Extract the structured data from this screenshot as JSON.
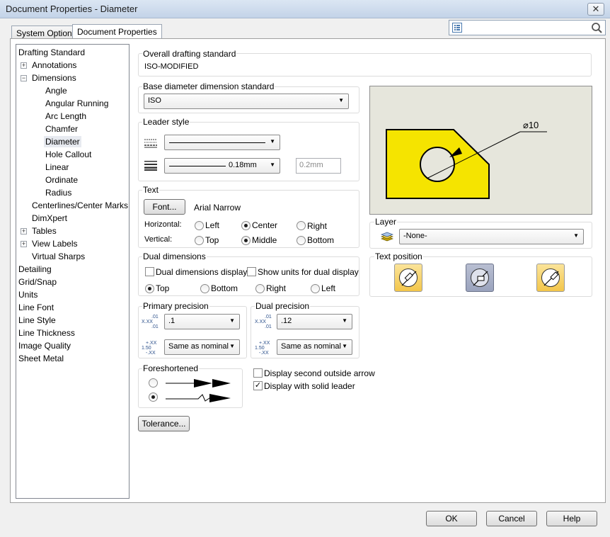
{
  "window": {
    "title": "Document Properties - Diameter",
    "close_label": "✕"
  },
  "tabs": [
    {
      "label": "System Options"
    },
    {
      "label": "Document Properties"
    }
  ],
  "search": {
    "value": "",
    "placeholder": ""
  },
  "tree": {
    "items": [
      {
        "label": "Drafting Standard"
      },
      {
        "label": "Annotations",
        "expander": "+"
      },
      {
        "label": "Dimensions",
        "expander": "−"
      },
      {
        "label": "Angle"
      },
      {
        "label": "Angular Running"
      },
      {
        "label": "Arc Length"
      },
      {
        "label": "Chamfer"
      },
      {
        "label": "Diameter"
      },
      {
        "label": "Hole Callout"
      },
      {
        "label": "Linear"
      },
      {
        "label": "Ordinate"
      },
      {
        "label": "Radius"
      },
      {
        "label": "Centerlines/Center Marks"
      },
      {
        "label": "DimXpert"
      },
      {
        "label": "Tables",
        "expander": "+"
      },
      {
        "label": "View Labels",
        "expander": "+"
      },
      {
        "label": "Virtual Sharps"
      },
      {
        "label": "Detailing"
      },
      {
        "label": "Grid/Snap"
      },
      {
        "label": "Units"
      },
      {
        "label": "Line Font"
      },
      {
        "label": "Line Style"
      },
      {
        "label": "Line Thickness"
      },
      {
        "label": "Image Quality"
      },
      {
        "label": "Sheet Metal"
      }
    ]
  },
  "overall": {
    "label": "Overall drafting standard",
    "value": "ISO-MODIFIED"
  },
  "base_standard": {
    "label": "Base diameter dimension standard",
    "value": "ISO"
  },
  "leader_style": {
    "label": "Leader style",
    "thickness_value": "0.18mm",
    "custom_thickness": "0.2mm"
  },
  "text": {
    "label": "Text",
    "font_button": "Font...",
    "font_name": "Arial Narrow",
    "horizontal_label": "Horizontal:",
    "vertical_label": "Vertical:",
    "horizontal": [
      "Left",
      "Center",
      "Right"
    ],
    "vertical": [
      "Top",
      "Middle",
      "Bottom"
    ]
  },
  "dual": {
    "label": "Dual dimensions",
    "display_label": "Dual dimensions display",
    "units_label": "Show units for dual display",
    "positions": [
      "Top",
      "Bottom",
      "Right",
      "Left"
    ]
  },
  "primary_precision": {
    "label": "Primary precision",
    "value": ".1",
    "tolerance": "Same as nominal",
    "icon_value": ".01",
    "icon_x": "X.XX",
    "icon_small": ".01",
    "icon_tol_top": "+.XX",
    "icon_tol_mid": "1.50",
    "icon_tol_bot": "-.XX"
  },
  "dual_precision": {
    "label": "Dual precision",
    "value": ".12",
    "tolerance": "Same as nominal",
    "icon_value": ".01",
    "icon_x": "X.XX",
    "icon_small": ".01",
    "icon_tol_top": "+.XX",
    "icon_tol_mid": "1.50",
    "icon_tol_bot": "-.XX"
  },
  "foreshortened": {
    "label": "Foreshortened"
  },
  "options": {
    "second_arrow": "Display second outside arrow",
    "solid_leader": "Display with solid leader"
  },
  "tolerance_button": "Tolerance...",
  "preview": {
    "dimension_text": "⌀10"
  },
  "layer": {
    "label": "Layer",
    "value": "-None-"
  },
  "text_position": {
    "label": "Text position"
  },
  "buttons": {
    "ok": "OK",
    "cancel": "Cancel",
    "help": "Help"
  },
  "colors": {
    "part_fill": "#f5e400",
    "preview_bg": "#e6e6dc",
    "selected_bg": "#e7eaf0"
  }
}
